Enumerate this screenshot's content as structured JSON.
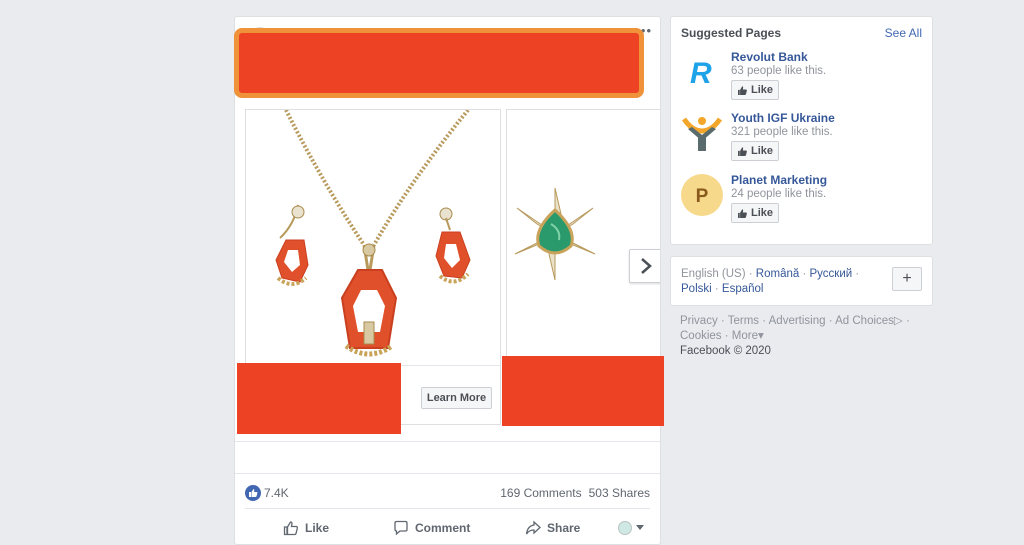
{
  "post": {
    "more_label": "•••",
    "cards": [
      {
        "cta_label": "Learn More"
      }
    ],
    "reactions_count": "7.4K",
    "comments_count": "169 Comments",
    "shares_count": "503 Shares",
    "actions": {
      "like": "Like",
      "comment": "Comment",
      "share": "Share"
    }
  },
  "sidebar": {
    "title": "Suggested Pages",
    "see_all": "See All",
    "pages": [
      {
        "name": "Revolut Bank",
        "likes": "63 people like this.",
        "button": "Like",
        "logo": "revolut-logo"
      },
      {
        "name": "Youth IGF Ukraine",
        "likes": "321 people like this.",
        "button": "Like",
        "logo": "youth-igf-logo"
      },
      {
        "name": "Planet Marketing",
        "likes": "24 people like this.",
        "button": "Like",
        "logo": "planet-marketing-logo",
        "logo_letter": "P"
      }
    ]
  },
  "languages": {
    "current": "English (US)",
    "links": [
      "Română",
      "Русский",
      "Polski",
      "Español"
    ],
    "add_label": "+"
  },
  "footer": {
    "links": [
      "Privacy",
      "Terms",
      "Advertising",
      "Ad Choices",
      "Cookies",
      "More"
    ],
    "copyright": "Facebook © 2020"
  },
  "colors": {
    "accent": "#4267b2",
    "link": "#365899",
    "redaction": "#ee4224",
    "redaction_border": "#f0923a"
  }
}
